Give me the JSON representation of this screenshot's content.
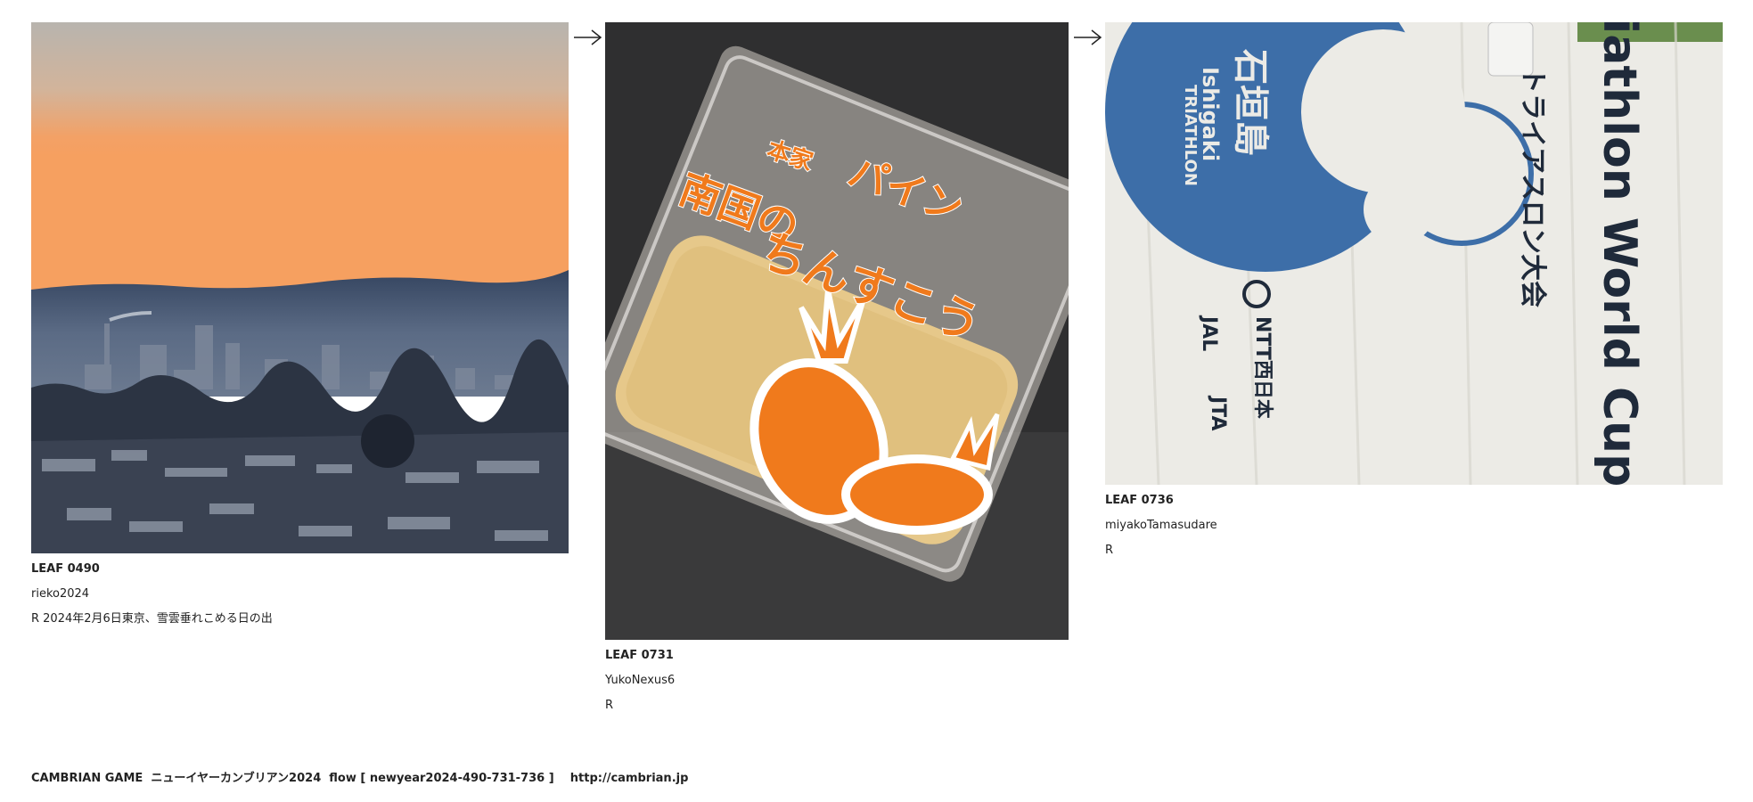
{
  "leaves": [
    {
      "id": "LEAF 0490",
      "author": "rieko2024",
      "note": "R 2024年2月6日東京、雪雲垂れこめる日の出"
    },
    {
      "id": "LEAF 0731",
      "author": "YukoNexus6",
      "note": "R",
      "package_text": {
        "line1": "南国の",
        "line2": "パイン",
        "line3": "ちんすこう",
        "small": "本家"
      }
    },
    {
      "id": "LEAF 0736",
      "author": "miyakoTamasudare",
      "note": "R",
      "towel_text": {
        "title": "Triathlon World Cup",
        "jp": "トライアスロン大会",
        "brand": "石垣島",
        "brand_en": "Ishigaki",
        "sub": "TRIATHLON",
        "sponsor1": "NTT西日本",
        "sponsor2": "JAL",
        "sponsor3": "JTA"
      }
    }
  ],
  "footer": {
    "text": "CAMBRIAN GAME  ニューイヤーカンブリアン2024  flow [ newyear2024-490-731-736 ]    ",
    "link": "http://cambrian.jp"
  },
  "colors": {
    "sky_top": "#b9b3ad",
    "sky_orange": "#f0a46a",
    "cloud_blue": "#3e4f6a",
    "pine_orange": "#f07a1c",
    "towel_blue": "#3d6ea8"
  }
}
